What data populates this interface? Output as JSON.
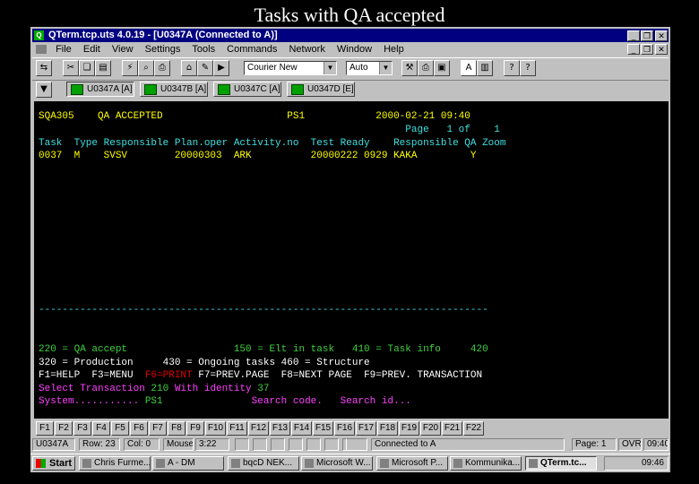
{
  "slide_title": "Tasks with QA accepted",
  "window": {
    "title": "QTerm.tcp.uts 4.0.19 - [U0347A (Connected to A)]",
    "minimize": "_",
    "restore": "❐",
    "close": "✕"
  },
  "menu": [
    "File",
    "Edit",
    "View",
    "Settings",
    "Tools",
    "Commands",
    "Network",
    "Window",
    "Help"
  ],
  "toolbar": {
    "font_value": "Courier New",
    "size_value": "Auto"
  },
  "sessions": [
    "U0347A [A]",
    "U0347B [A]",
    "U0347C [A]",
    "U0347D [E]"
  ],
  "terminal": {
    "l1": {
      "a": "SQA305    QA ACCEPTED                     PS1            ",
      "b": "2000-02-21 09:40"
    },
    "l2": "                                                              Page   1 of    1",
    "l3": "Task  Type Responsible Plan.oper Activity.no  Test Ready    Responsible QA Zoom",
    "l4": {
      "a": "0037  M    SVSV        20000303  ARK          20000222 0929 ",
      "b": "KAKA",
      "c": "         Y"
    },
    "separator": "----------------------------------------------------------------------------",
    "l5": "220 = QA accept                  150 = Elt in task   410 = Task info     420",
    "l6": "320 = Production     430 = Ongoing tasks 460 = Structure",
    "l7": {
      "a": "F1=HELP  F3=MENU  ",
      "b": "F6=PRINT",
      "c": " F7=PREV.PAGE  F8=NEXT PAGE  F9=PREV. TRANSACTION"
    },
    "l8": {
      "a": "Select Transaction ",
      "b": "210",
      "c": " With identity ",
      "d": "37"
    },
    "l9": {
      "a": "System........... ",
      "b": "PS1",
      "c": "               Search code.   Search id..."
    }
  },
  "fkeys": [
    "F1",
    "F2",
    "F3",
    "F4",
    "F5",
    "F6",
    "F7",
    "F8",
    "F9",
    "F10",
    "F11",
    "F12",
    "F13",
    "F14",
    "F15",
    "F16",
    "F17",
    "F18",
    "F19",
    "F20",
    "F21",
    "F22"
  ],
  "status": {
    "session": "U0347A",
    "row": "Row: 23",
    "col": "Col: 0",
    "mouse": "Mouse:",
    "mouse_pos": "3:22",
    "connected": "Connected to A",
    "page": "Page: 1",
    "mode": "OVR",
    "time": "09:40"
  },
  "taskbar": {
    "start": "Start",
    "items": [
      "Chris Furme...",
      "A - DM",
      "bqcD NEK...",
      "Microsoft W...",
      "Microsoft P...",
      "Kommunika...",
      "QTerm.tc..."
    ],
    "clock": "09:46"
  },
  "colors": {
    "title_bar": "#000080",
    "terminal_bg": "#000000",
    "yellow": "#ffff00",
    "cyan": "#40e0e0",
    "green": "#40d040",
    "magenta": "#ff40ff",
    "red": "#e00000"
  }
}
